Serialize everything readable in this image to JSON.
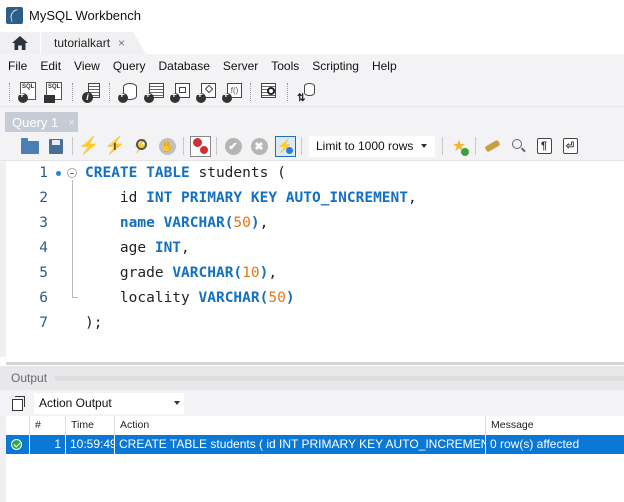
{
  "window": {
    "title": "MySQL Workbench"
  },
  "tabs": {
    "home_icon": "home-icon",
    "connection_tab": {
      "label": "tutorialkart",
      "close": "×"
    }
  },
  "menu": [
    "File",
    "Edit",
    "View",
    "Query",
    "Database",
    "Server",
    "Tools",
    "Scripting",
    "Help"
  ],
  "main_toolbar": {
    "icons": [
      "new-sql-tab-icon",
      "open-sql-script-icon",
      "inspect-schema-icon",
      "create-schema-icon",
      "create-table-icon",
      "create-view-icon",
      "create-procedure-icon",
      "create-function-icon",
      "search-table-data-icon",
      "reconnect-icon"
    ]
  },
  "query_tab": {
    "label": "Query 1",
    "close": "×"
  },
  "sql_toolbar": {
    "limit_select": {
      "value": "Limit to 1000 rows"
    },
    "icons": [
      "open-file-icon",
      "save-icon",
      "execute-icon",
      "execute-current-icon",
      "explain-icon",
      "stop-icon",
      "toggle-error-icon",
      "commit-icon",
      "rollback-icon",
      "autocommit-icon",
      "add-snippet-icon",
      "beautify-icon",
      "find-icon",
      "invisible-chars-icon",
      "wrap-lines-icon"
    ]
  },
  "editor": {
    "lines": [
      {
        "n": "1",
        "tokens": [
          {
            "t": "CREATE TABLE",
            "c": "kw"
          },
          {
            "t": " students (",
            "c": ""
          }
        ]
      },
      {
        "n": "2",
        "tokens": [
          {
            "t": "    id ",
            "c": ""
          },
          {
            "t": "INT PRIMARY KEY AUTO_INCREMENT",
            "c": "kw"
          },
          {
            "t": ",",
            "c": ""
          }
        ]
      },
      {
        "n": "3",
        "tokens": [
          {
            "t": "    ",
            "c": ""
          },
          {
            "t": "name VARCHAR",
            "c": "kw"
          },
          {
            "t": "(",
            "c": "kw"
          },
          {
            "t": "50",
            "c": "num"
          },
          {
            "t": ")",
            "c": "kw"
          },
          {
            "t": ",",
            "c": ""
          }
        ]
      },
      {
        "n": "4",
        "tokens": [
          {
            "t": "    age ",
            "c": ""
          },
          {
            "t": "INT",
            "c": "kw"
          },
          {
            "t": ",",
            "c": ""
          }
        ]
      },
      {
        "n": "5",
        "tokens": [
          {
            "t": "    grade ",
            "c": ""
          },
          {
            "t": "VARCHAR",
            "c": "kw"
          },
          {
            "t": "(",
            "c": "kw"
          },
          {
            "t": "10",
            "c": "num"
          },
          {
            "t": ")",
            "c": "kw"
          },
          {
            "t": ",",
            "c": ""
          }
        ]
      },
      {
        "n": "6",
        "tokens": [
          {
            "t": "    locality ",
            "c": ""
          },
          {
            "t": "VARCHAR",
            "c": "kw"
          },
          {
            "t": "(",
            "c": "kw"
          },
          {
            "t": "50",
            "c": "num"
          },
          {
            "t": ")",
            "c": "kw"
          }
        ]
      },
      {
        "n": "7",
        "tokens": [
          {
            "t": ");",
            "c": ""
          }
        ]
      }
    ]
  },
  "output": {
    "title": "Output",
    "select_value": "Action Output",
    "columns": [
      "",
      "#",
      "Time",
      "Action",
      "Message"
    ],
    "rows": [
      {
        "status": "success",
        "num": "1",
        "time": "10:59:49",
        "action": "CREATE TABLE students (     id INT PRIMARY KEY AUTO_INCREMENT...",
        "message": "0 row(s) affected"
      }
    ]
  },
  "colors": {
    "keyword": "#1470c0",
    "number": "#e07818",
    "selection": "#0a78d4",
    "success": "#2ea84a"
  }
}
